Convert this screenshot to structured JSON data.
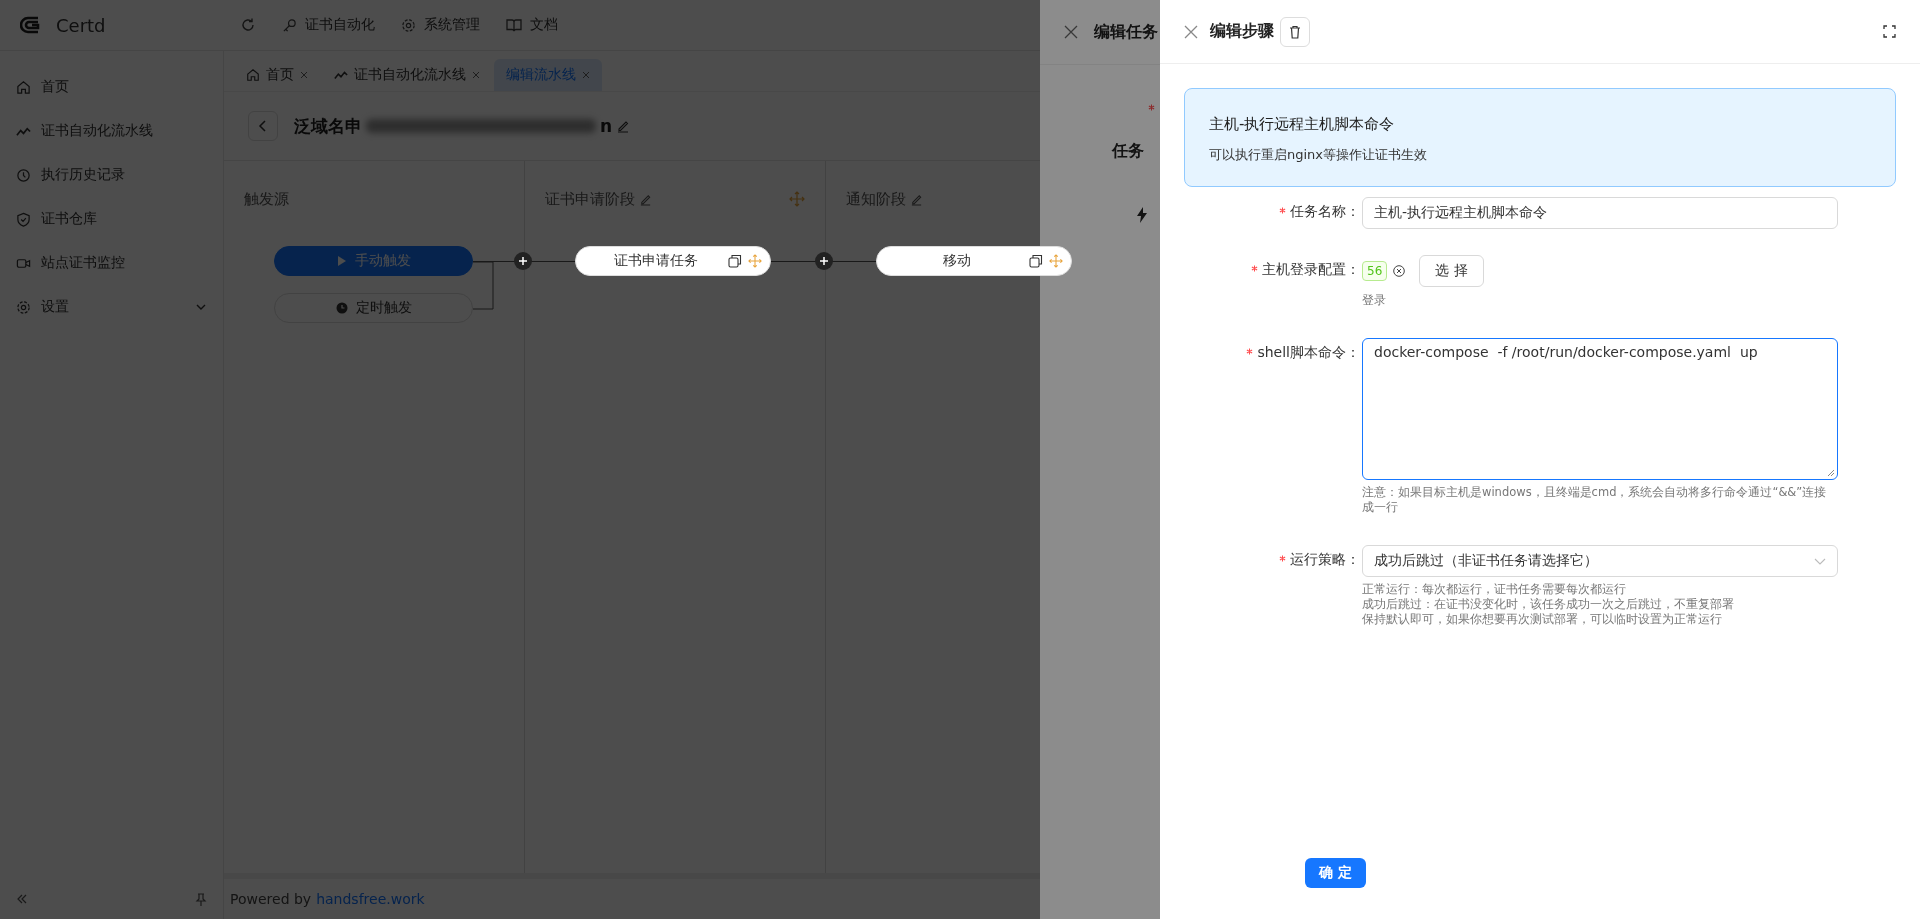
{
  "app": {
    "logo": "Certd",
    "topnav": [
      {
        "label": "证书自动化"
      },
      {
        "label": "系统管理"
      },
      {
        "label": "文档"
      }
    ]
  },
  "sidebar": {
    "items": [
      {
        "label": "首页",
        "expandable": false
      },
      {
        "label": "证书自动化流水线",
        "expandable": false
      },
      {
        "label": "执行历史记录",
        "expandable": false
      },
      {
        "label": "证书仓库",
        "expandable": false
      },
      {
        "label": "站点证书监控",
        "expandable": false
      },
      {
        "label": "设置",
        "expandable": true
      }
    ]
  },
  "tabs": [
    {
      "label": "首页",
      "selected": false
    },
    {
      "label": "证书自动化流水线",
      "selected": false
    },
    {
      "label": "编辑流水线",
      "selected": true
    }
  ],
  "pipeline": {
    "title": "泛域名申",
    "title_end": "n",
    "stages": [
      {
        "title": "触发源",
        "editable": false,
        "triggers": [
          {
            "label": "手动触发",
            "selected": true
          },
          {
            "label": "定时触发",
            "selected": false
          }
        ]
      },
      {
        "title": "证书申请阶段",
        "editable": true,
        "tasks": [
          {
            "label": "证书申请任务"
          }
        ]
      },
      {
        "title": "通知阶段",
        "editable": true,
        "tasks": [
          {
            "label": "移动"
          }
        ]
      }
    ]
  },
  "footer": {
    "prefix": "Powered by",
    "link": "handsfree.work"
  },
  "task_drawer": {
    "title": "编辑任务",
    "fields": [
      {
        "required": true
      },
      {
        "label": "任务",
        "required": false
      }
    ]
  },
  "step_drawer": {
    "title": "编辑步骤",
    "alert": {
      "title": "主机-执行远程主机脚本命令",
      "description": "可以执行重启nginx等操作让证书生效"
    },
    "fields": [
      {
        "kind": "text",
        "label": "任务名称：",
        "required": true,
        "value": "主机-执行远程主机脚本命令"
      },
      {
        "kind": "access",
        "label": "主机登录配置：",
        "required": true,
        "tag": "56",
        "button": "选 择",
        "help": [
          "登录"
        ]
      },
      {
        "kind": "textarea",
        "label": "shell脚本命令：",
        "required": true,
        "value": "docker-compose  -f /root/run/docker-compose.yaml  up",
        "help": [
          "注意：如果目标主机是windows，且终端是cmd，系统会自动将多行命令通过“&&”连接成一行"
        ]
      },
      {
        "kind": "select",
        "label": "运行策略：",
        "required": true,
        "value": "成功后跳过（非证书任务请选择它）",
        "help": [
          "正常运行：每次都运行，证书任务需要每次都运行",
          "成功后跳过：在证书没变化时，该任务成功一次之后跳过，不重复部署",
          "保持默认即可，如果你想要再次测试部署，可以临时设置为正常运行"
        ]
      }
    ],
    "submit": "确 定"
  }
}
